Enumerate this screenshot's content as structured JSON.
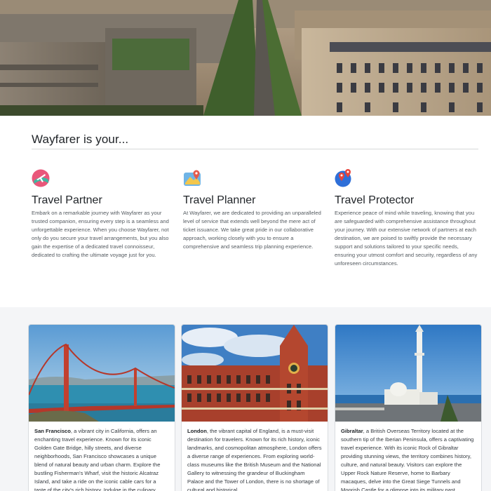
{
  "hero": {
    "icon": "paris-street-aerial-photo"
  },
  "intro": {
    "title": "Wayfarer is your...",
    "features": [
      {
        "icon": "airplane-map-icon",
        "title": "Travel Partner",
        "text": "Embark on a remarkable journey with Wayfarer as your trusted companion, ensuring every step is a seamless and unforgettable experience. When you choose Wayfarer, not only do you secure your travel arrangements, but you also gain the expertise of a dedicated travel connoisseur, dedicated to crafting the ultimate voyage just for you."
      },
      {
        "icon": "map-pin-planner-icon",
        "title": "Travel Planner",
        "text": "At Wayfarer, we are dedicated to providing an unparalleled level of service that extends well beyond the mere act of ticket issuance. We take great pride in our collaborative approach, working closely with you to ensure a comprehensive and seamless trip planning experience."
      },
      {
        "icon": "location-pins-icon",
        "title": "Travel Protector",
        "text": "Experience peace of mind while traveling, knowing that you are safeguarded with comprehensive assistance throughout your journey. With our extensive network of partners at each destination, we are poised to swiftly provide the necessary support and solutions tailored to your specific needs, ensuring your utmost comfort and security, regardless of any unforeseen circumstances."
      }
    ]
  },
  "cards": [
    {
      "city": "San Francisco",
      "text": ", a vibrant city in California, offers an enchanting travel experience. Known for its iconic Golden Gate Bridge, hilly streets, and diverse neighborhoods, San Francisco showcases a unique blend of natural beauty and urban charm. Explore the bustling Fisherman's Wharf, visit the historic Alcatraz Island, and take a ride on the iconic cable cars for a taste of the city's rich history. Indulge in the culinary"
    },
    {
      "city": "London",
      "text": ", the vibrant capital of England, is a must-visit destination for travelers. Known for its rich history, iconic landmarks, and cosmopolitan atmosphere, London offers a diverse range of experiences. From exploring world-class museums like the British Museum and the National Gallery to witnessing the grandeur of Buckingham Palace and the Tower of London, there is no shortage of cultural and historical"
    },
    {
      "city": "Gibraltar",
      "text": ", a British Overseas Territory located at the southern tip of the Iberian Peninsula, offers a captivating travel experience. With its iconic Rock of Gibraltar providing stunning views, the territory combines history, culture, and natural beauty. Visitors can explore the Upper Rock Nature Reserve, home to Barbary macaques, delve into the Great Siege Tunnels and Moorish Castle for a glimpse into its military past"
    }
  ]
}
